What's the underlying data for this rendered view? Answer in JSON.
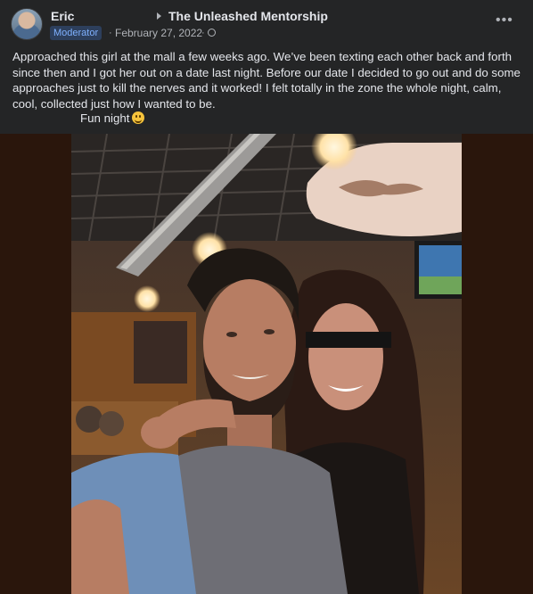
{
  "post": {
    "author": "Eric",
    "group": "The Unleashed Mentorship",
    "badge": "Moderator",
    "separator": "·",
    "date": "February 27, 2022",
    "paragraph": "Approached this girl at the mall a few weeks ago. We’ve been texting each other back and forth since then and I got her out on a date last night. Before our date I decided to go out and do some approaches just to kill the nerves and it worked! I felt totally in the zone the whole night, calm, cool, collected just how I wanted to be.",
    "fun_line": "Fun night",
    "more_glyph": "•••"
  },
  "colors": {
    "background": "#242526",
    "text": "#e4e6eb",
    "secondary": "#b0b3b8",
    "badge_bg": "#2d3f5c",
    "badge_text": "#7fb1ff",
    "media_bg": "#2a160c"
  },
  "icons": {
    "arrow": "caret-right-icon",
    "privacy": "globe-icon",
    "more": "more-icon",
    "emoji": "smiley-emoji-icon"
  }
}
